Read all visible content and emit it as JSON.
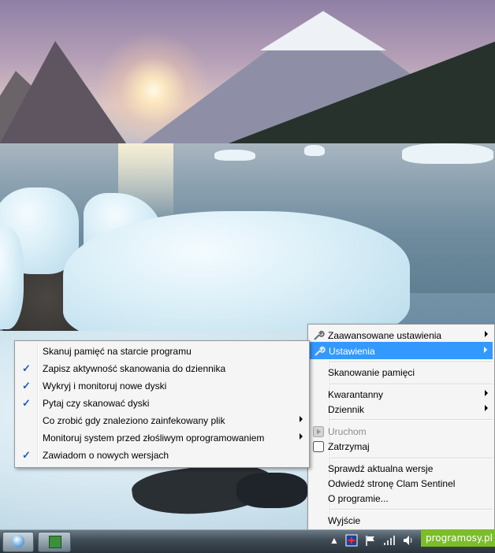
{
  "tray_menu": {
    "items": [
      {
        "label": "Zaawansowane ustawienia",
        "icon": "wrench-icon",
        "submenu": true
      },
      {
        "label": "Ustawienia",
        "icon": "wrench-icon",
        "submenu": true,
        "selected": true
      },
      {
        "label": "Skanowanie pamięci"
      },
      {
        "label": "Kwarantanny",
        "submenu": true
      },
      {
        "label": "Dziennik",
        "submenu": true
      },
      {
        "label": "Uruchom",
        "icon": "play-icon",
        "disabled": true
      },
      {
        "label": "Zatrzymaj",
        "icon": "stop-icon"
      },
      {
        "label": "Sprawdź aktualna wersje"
      },
      {
        "label": "Odwiedź stronę Clam Sentinel"
      },
      {
        "label": "O programie..."
      },
      {
        "label": "Wyjście"
      }
    ]
  },
  "settings_menu": {
    "items": [
      {
        "label": "Skanuj pamięć na starcie programu",
        "checked": false
      },
      {
        "label": "Zapisz aktywność skanowania do dziennika",
        "checked": true
      },
      {
        "label": "Wykryj i monitoruj nowe dyski",
        "checked": true
      },
      {
        "label": "Pytaj czy skanować dyski",
        "checked": true
      },
      {
        "label": "Co zrobić gdy znaleziono zainfekowany plik",
        "submenu": true
      },
      {
        "label": "Monitoruj system przed złośliwym oprogramowaniem",
        "submenu": true
      },
      {
        "label": "Zawiadom o nowych wersjach",
        "checked": true
      }
    ],
    "check_mark": "✓"
  },
  "taskbar": {
    "tray_arrow": "▲",
    "brand": "programosy.pl"
  },
  "colors": {
    "menu_bg": "#f5f5f5",
    "selected": "#3399ff",
    "check": "#1d5bbf",
    "brand": "#7cbd2a"
  }
}
